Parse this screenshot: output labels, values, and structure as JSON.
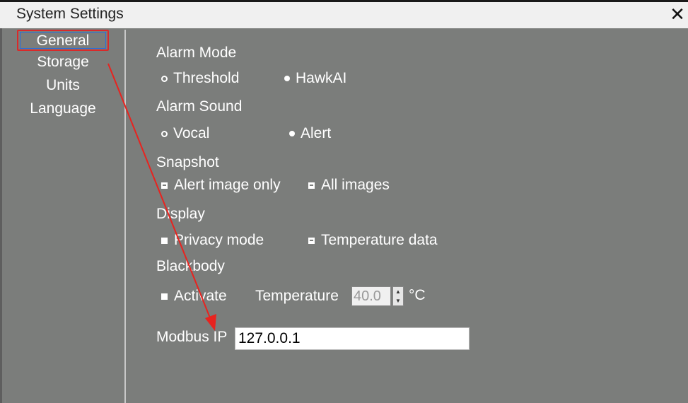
{
  "window": {
    "title": "System Settings"
  },
  "sidebar": {
    "items": [
      {
        "label": "General"
      },
      {
        "label": "Storage"
      },
      {
        "label": "Units"
      },
      {
        "label": "Language"
      }
    ]
  },
  "alarm_mode": {
    "label": "Alarm Mode",
    "options": [
      "Threshold",
      "HawkAI"
    ]
  },
  "alarm_sound": {
    "label": "Alarm Sound",
    "options": [
      "Vocal",
      "Alert"
    ]
  },
  "snapshot": {
    "label": "Snapshot",
    "options": [
      "Alert image only",
      "All images"
    ]
  },
  "display": {
    "label": "Display",
    "options": [
      "Privacy mode",
      "Temperature data"
    ]
  },
  "blackbody": {
    "label": "Blackbody",
    "activate_label": "Activate",
    "temperature_label": "Temperature",
    "temperature_value": "40.0",
    "unit": "°C"
  },
  "modbus": {
    "label": "Modbus IP",
    "value": "127.0.0.1"
  },
  "annotation": {
    "highlight_color": "#d92a2a",
    "arrow_color": "#e8231f"
  }
}
